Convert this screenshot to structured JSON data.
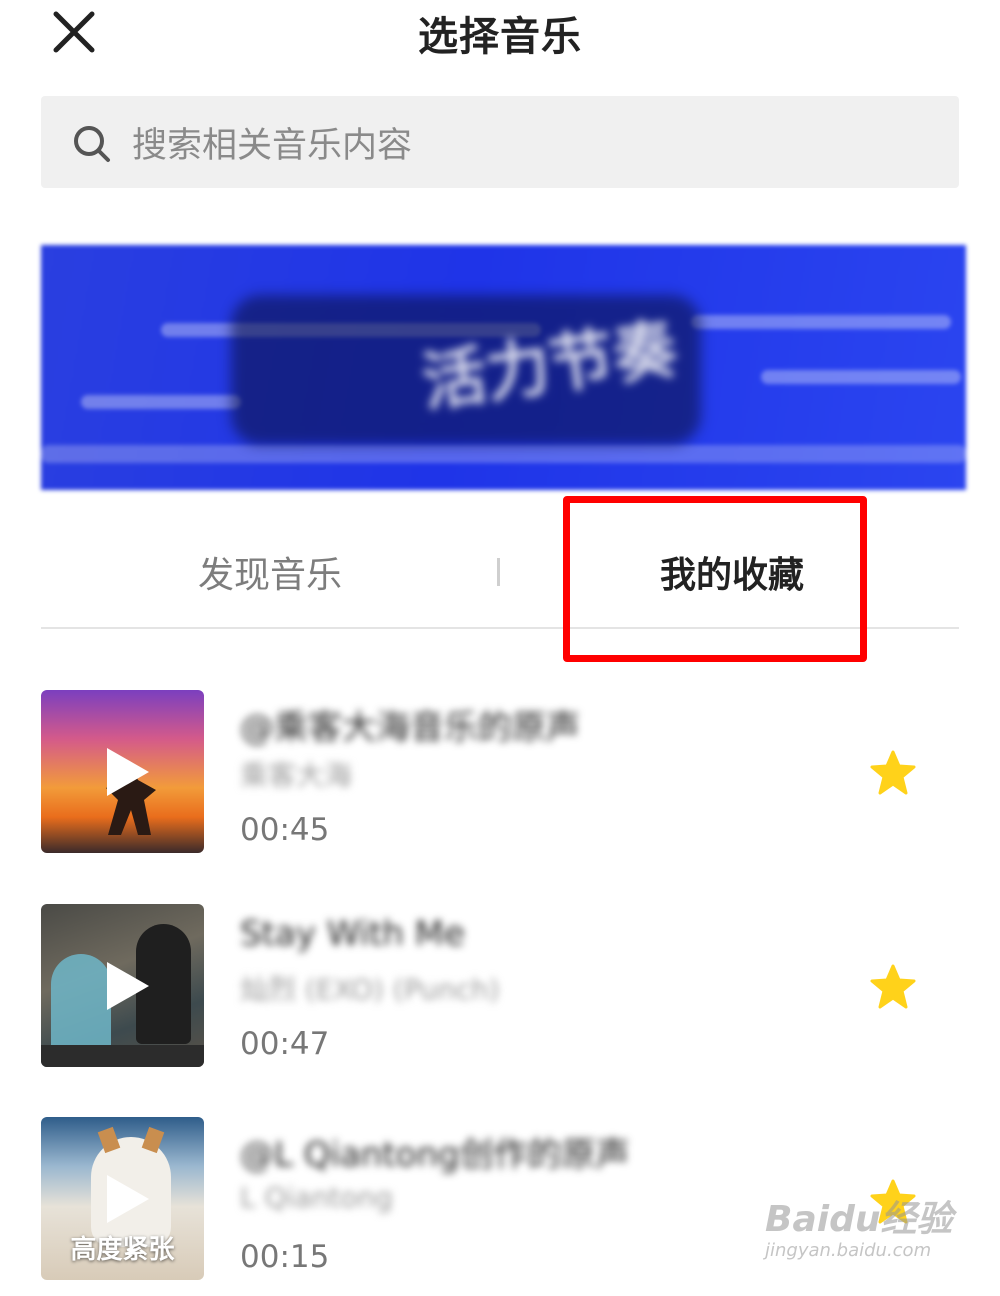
{
  "header": {
    "title": "选择音乐"
  },
  "search": {
    "placeholder": "搜索相关音乐内容"
  },
  "banner": {
    "text": "活力节奏"
  },
  "tabs": [
    {
      "label": "发现音乐",
      "active": false
    },
    {
      "label": "我的收藏",
      "active": true
    }
  ],
  "songs": [
    {
      "title": "@乘客大海音乐的原声",
      "artist": "乘客大海",
      "duration": "00:45",
      "cover_caption": "",
      "favorited": true
    },
    {
      "title": "Stay With Me",
      "artist": "灿烈 (EXO) (Punch)",
      "duration": "00:47",
      "cover_caption": "",
      "favorited": true
    },
    {
      "title": "@L Qiantong创作的原声",
      "artist": "L Qiantong",
      "duration": "00:15",
      "cover_caption": "高度紧张",
      "favorited": true
    }
  ],
  "watermark": {
    "main": "Baidu经验",
    "sub": "jingyan.baidu.com"
  },
  "colors": {
    "star": "#ffd21a",
    "highlight": "#ff0000",
    "banner": "#2337e6"
  }
}
